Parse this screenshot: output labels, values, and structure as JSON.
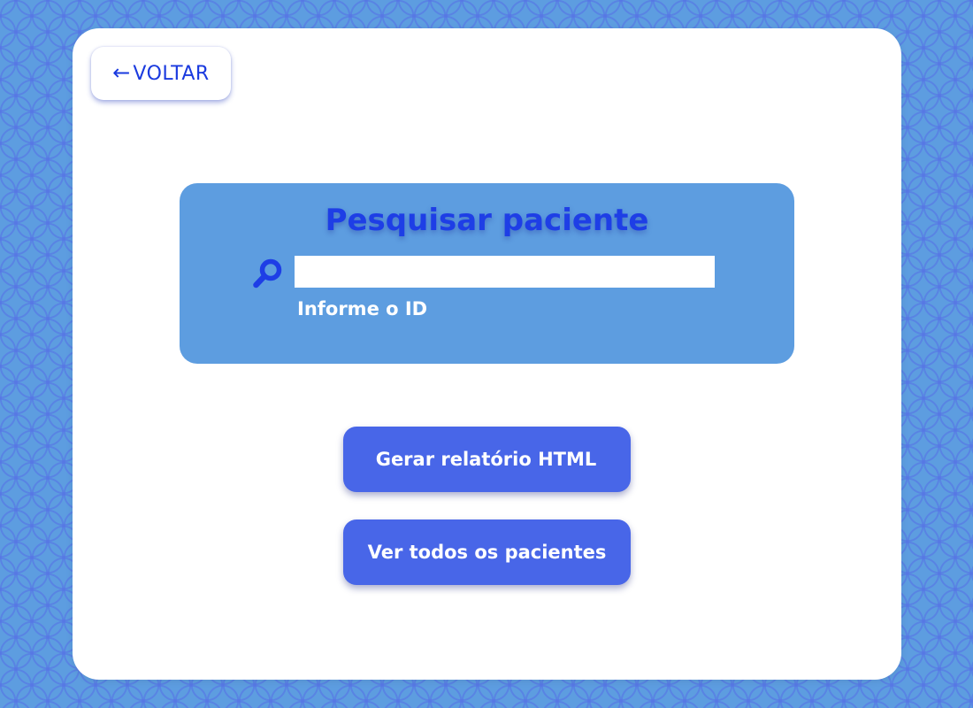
{
  "back_button": {
    "arrow": "←",
    "label": "VOLTAR"
  },
  "search": {
    "title": "Pesquisar paciente",
    "icon": "search-icon",
    "input_value": "",
    "hint": "Informe o ID"
  },
  "actions": {
    "report_label": "Gerar relatório HTML",
    "all_patients_label": "Ver todos os pacientes"
  },
  "colors": {
    "background": "#5d9de0",
    "accent": "#1e3ee6",
    "button": "#4866e8",
    "card": "#ffffff"
  }
}
